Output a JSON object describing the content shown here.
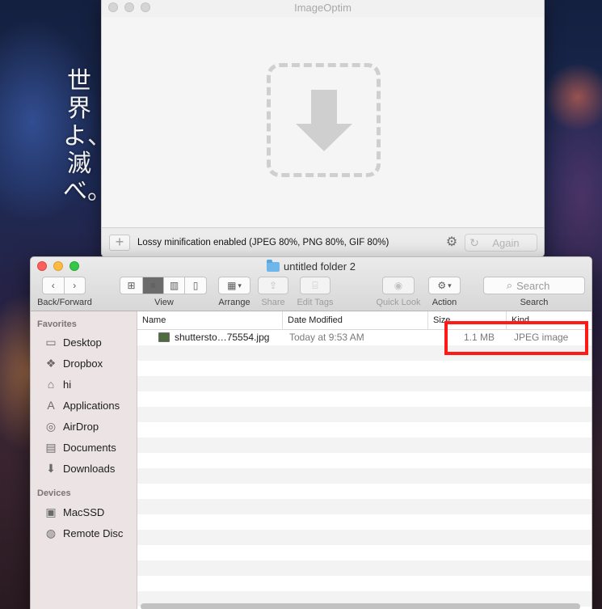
{
  "wallpaper": {
    "text": "世界よ、滅べ。"
  },
  "imageoptim": {
    "title": "ImageOptim",
    "add_label": "+",
    "status": "Lossy minification enabled (JPEG 80%, PNG 80%, GIF 80%)",
    "again_label": "Again",
    "icons": {
      "drop": "download-arrow-icon",
      "settings": "gear-icon",
      "again": "refresh-icon"
    }
  },
  "finder": {
    "title": "untitled folder 2",
    "toolbar": {
      "back_forward_label": "Back/Forward",
      "view_label": "View",
      "arrange_label": "Arrange",
      "share_label": "Share",
      "edit_tags_label": "Edit Tags",
      "quick_look_label": "Quick Look",
      "action_label": "Action",
      "search_label": "Search",
      "search_placeholder": "Search",
      "active_view": "list"
    },
    "sidebar": {
      "favorites_header": "Favorites",
      "favorites": [
        {
          "label": "Desktop",
          "icon": "desktop-icon"
        },
        {
          "label": "Dropbox",
          "icon": "dropbox-icon"
        },
        {
          "label": "hi",
          "icon": "home-icon"
        },
        {
          "label": "Applications",
          "icon": "applications-icon"
        },
        {
          "label": "AirDrop",
          "icon": "airdrop-icon"
        },
        {
          "label": "Documents",
          "icon": "documents-icon"
        },
        {
          "label": "Downloads",
          "icon": "downloads-icon"
        }
      ],
      "devices_header": "Devices",
      "devices": [
        {
          "label": "MacSSD",
          "icon": "disk-icon"
        },
        {
          "label": "Remote Disc",
          "icon": "remote-disc-icon"
        }
      ]
    },
    "columns": {
      "name": "Name",
      "date_modified": "Date Modified",
      "size": "Size",
      "kind": "Kind"
    },
    "files": [
      {
        "name": "shuttersto…75554.jpg",
        "date_modified": "Today at 9:53 AM",
        "size": "1.1 MB",
        "kind": "JPEG image"
      }
    ],
    "highlight_color": "#ff1a16"
  }
}
